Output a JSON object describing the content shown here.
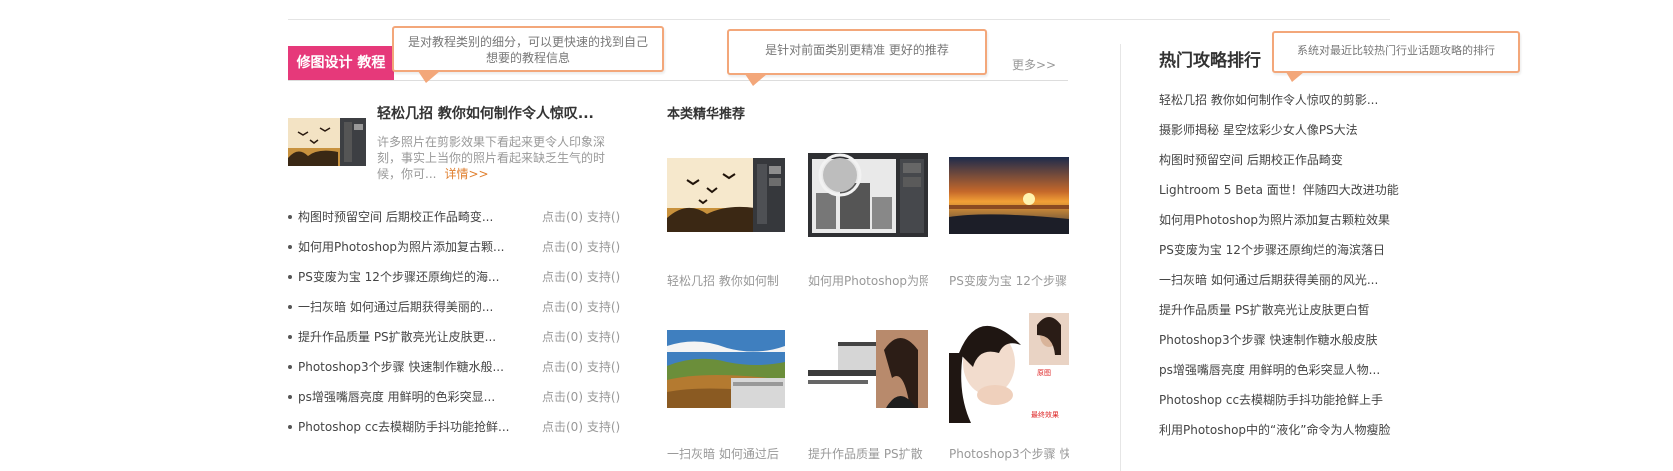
{
  "section": {
    "title": "修图设计 教程",
    "more": "更多>>"
  },
  "bubbles": {
    "b1": "是对教程类别的细分，可以更快速的找到自己想要的教程信息",
    "b2": "是针对前面类别更精准 更好的推荐",
    "b3": "系统对最近比较热门行业话题攻略的排行"
  },
  "featured": {
    "title": "轻松几招 教你如何制作令人惊叹...",
    "desc": "许多照片在剪影效果下看起来更令人印象深刻，事实上当你的照片看起来缺乏生气的时候，你可...",
    "more": "详情>>"
  },
  "articles": [
    {
      "title": "构图时预留空间 后期校正作品畸变...",
      "stats": "点击(0) 支持()"
    },
    {
      "title": "如何用Photoshop为照片添加复古颗...",
      "stats": "点击(0) 支持()"
    },
    {
      "title": "PS变废为宝 12个步骤还原绚烂的海...",
      "stats": "点击(0) 支持()"
    },
    {
      "title": "一扫灰暗 如何通过后期获得美丽的...",
      "stats": "点击(0) 支持()"
    },
    {
      "title": "提升作品质量 PS扩散亮光让皮肤更...",
      "stats": "点击(0) 支持()"
    },
    {
      "title": "Photoshop3个步骤 快速制作糖水般...",
      "stats": "点击(0) 支持()"
    },
    {
      "title": "ps增强嘴唇亮度 用鲜明的色彩突显...",
      "stats": "点击(0) 支持()"
    },
    {
      "title": "Photoshop cc去模糊防手抖功能抢鲜...",
      "stats": "点击(0) 支持()"
    }
  ],
  "recommend": {
    "title": "本类精华推荐",
    "items": [
      {
        "caption": "轻松几招 教你如何制"
      },
      {
        "caption": "如何用Photoshop为照"
      },
      {
        "caption": "PS变废为宝 12个步骤"
      },
      {
        "caption": "一扫灰暗 如何通过后"
      },
      {
        "caption": "提升作品质量 PS扩散"
      },
      {
        "caption": "Photoshop3个步骤 快"
      }
    ],
    "overlay_labels": {
      "original": "原图",
      "result": "最终效果"
    }
  },
  "hot": {
    "title": "热门攻略排行",
    "items": [
      "轻松几招 教你如何制作令人惊叹的剪影...",
      "摄影师揭秘 星空炫彩少女人像PS大法",
      "构图时预留空间 后期校正作品畸变",
      "Lightroom 5 Beta 面世！伴随四大改进功能",
      "如何用Photoshop为照片添加复古颗粒效果",
      "PS变废为宝 12个步骤还原绚烂的海滨落日",
      "一扫灰暗 如何通过后期获得美丽的风光...",
      "提升作品质量 PS扩散亮光让皮肤更白皙",
      "Photoshop3个步骤 快速制作糖水般皮肤",
      "ps增强嘴唇亮度 用鲜明的色彩突显人物...",
      "Photoshop cc去模糊防手抖功能抢鲜上手",
      "利用Photoshop中的“液化”命令为人物瘦脸"
    ]
  },
  "colors": {
    "accent": "#e6397a",
    "bubble_border": "#f3a77a",
    "more_link": "#e08030"
  }
}
